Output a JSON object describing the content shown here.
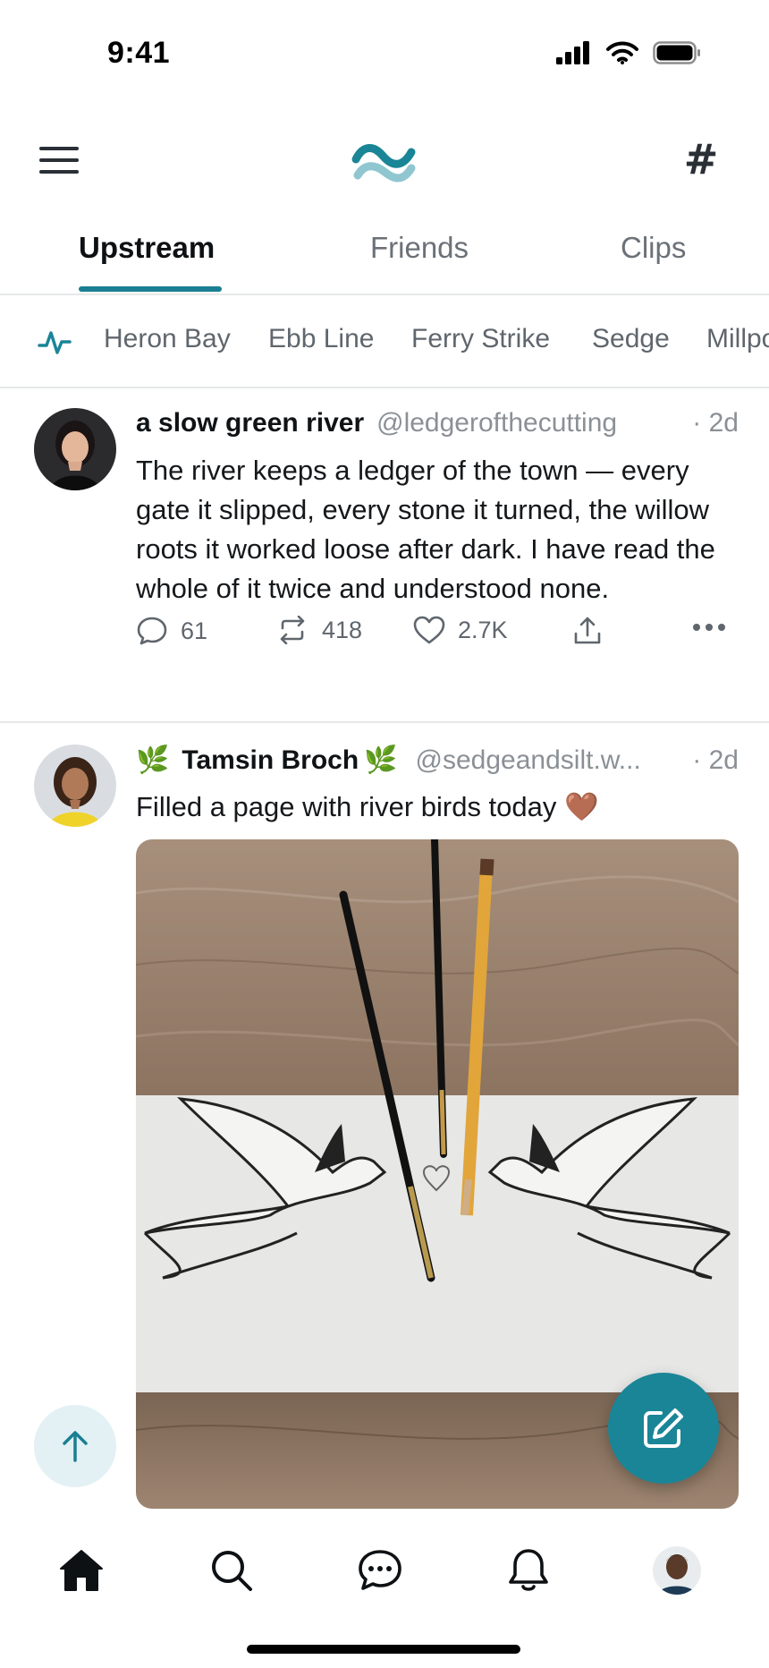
{
  "status_bar": {
    "time": "9:41",
    "icons": [
      "signal-icon",
      "wifi-icon",
      "battery-icon"
    ]
  },
  "header": {
    "left_icon": "menu-icon",
    "logo_icon": "wave-logo-icon",
    "right_icon": "hashtag-icon",
    "right_glyph": "#"
  },
  "tabs": [
    {
      "label": "Upstream",
      "active": true
    },
    {
      "label": "Friends",
      "active": false
    },
    {
      "label": "Clips",
      "active": false
    }
  ],
  "feeds": {
    "icon": "activity-pulse-icon",
    "items": [
      "Heron Bay",
      "Ebb Line",
      "Ferry Strike",
      "Sedge",
      "Millpond"
    ]
  },
  "posts": [
    {
      "display_name": "a slow green river",
      "handle": "@ledgerofthecutting",
      "time": "· 2d",
      "text": "The river keeps a ledger of the town — every gate it slipped, every stone it turned, the willow roots it worked loose after dark. I have read the whole of it twice and understood none.",
      "replies": "61",
      "reposts": "418",
      "likes": "2.7K"
    },
    {
      "name_prefix_emoji": "🌿",
      "display_name": "Tamsin Broch",
      "name_suffix_emoji": "🌿",
      "handle": "@sedgeandsilt.w...",
      "time": "· 2d",
      "text": "Filled a page with river birds today 🤎"
    }
  ],
  "fab": {
    "scroll_top_icon": "arrow-up-icon",
    "compose_icon": "compose-icon"
  },
  "bottom_nav": [
    "home-icon",
    "search-icon",
    "chat-icon",
    "bell-icon",
    "profile-avatar"
  ],
  "colors": {
    "accent": "#1a7f93",
    "text_primary": "#101316",
    "text_secondary": "#8a9096",
    "divider": "#e6e8ea"
  }
}
